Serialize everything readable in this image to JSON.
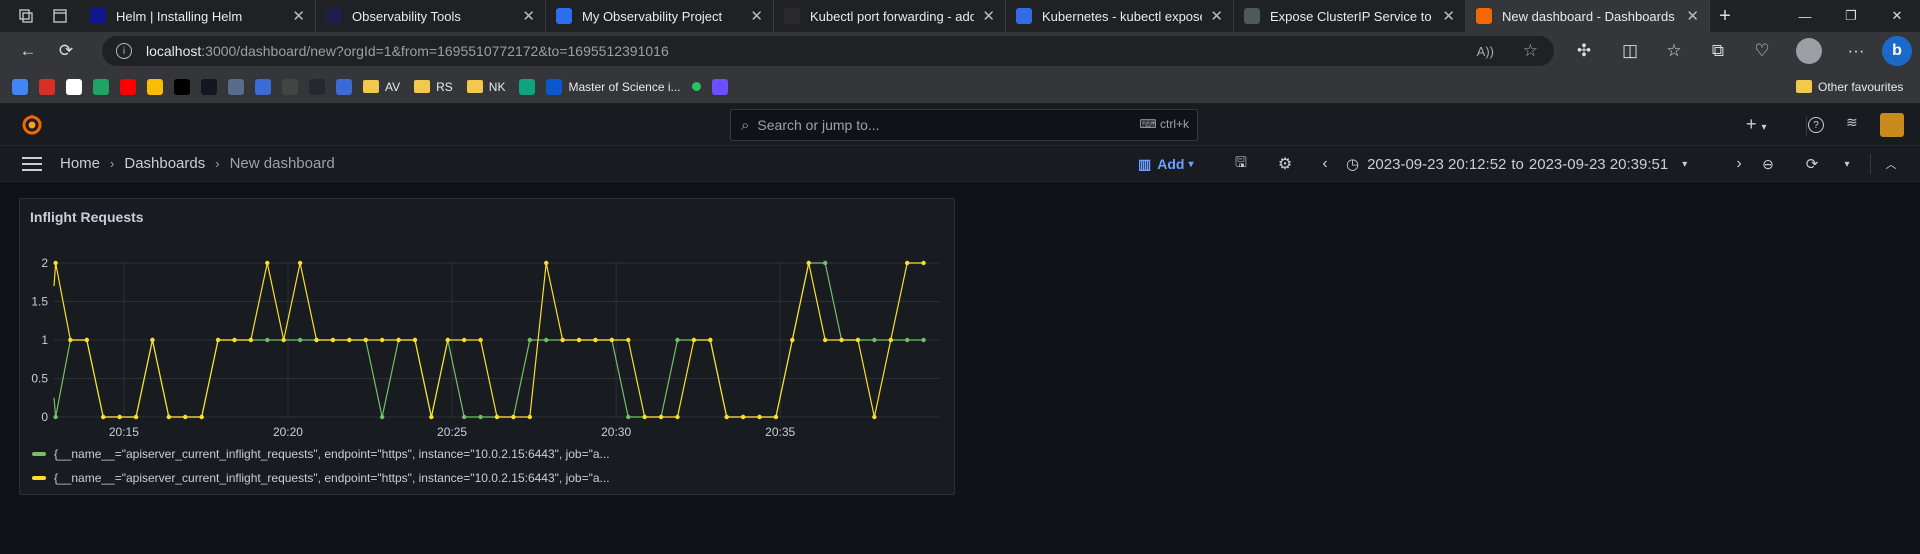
{
  "browser": {
    "tabs": [
      {
        "title": "Helm | Installing Helm",
        "color": "#0f1689",
        "icon": "helm-icon"
      },
      {
        "title": "Observability Tools",
        "color": "#1c1f4a",
        "icon": "observability-icon"
      },
      {
        "title": "My Observability Project",
        "color": "#2b6ff0",
        "icon": "project-icon"
      },
      {
        "title": "Kubectl port forwarding - addr",
        "color": "#2a2a2a",
        "icon": "s-icon"
      },
      {
        "title": "Kubernetes - kubectl expose",
        "color": "#326ce5",
        "icon": "kubernetes-icon"
      },
      {
        "title": "Expose ClusterIP Service to Inte",
        "color": "#4d5a56",
        "icon": "chatgpt-icon"
      },
      {
        "title": "New dashboard - Dashboards",
        "color": "#f46800",
        "icon": "grafana-icon",
        "active": true
      }
    ],
    "url_host": "localhost",
    "url_rest": ":3000/dashboard/new?orgId=1&from=1695510772172&to=1695512391016",
    "bookmarks": [
      {
        "type": "icon",
        "color": "#4285f4",
        "icon": "translate-icon"
      },
      {
        "type": "icon",
        "color": "#d93025",
        "icon": "gmail-icon"
      },
      {
        "type": "icon",
        "color": "#ffffff",
        "icon": "google-icon"
      },
      {
        "type": "icon",
        "color": "#1fa463",
        "icon": "drive-icon"
      },
      {
        "type": "icon",
        "color": "#ff0000",
        "icon": "youtube-icon"
      },
      {
        "type": "icon",
        "color": "#fbbc04",
        "icon": "photos-icon"
      },
      {
        "type": "icon",
        "color": "#000000",
        "icon": "x-icon"
      },
      {
        "type": "icon",
        "color": "#131722",
        "icon": "tradingview-icon"
      },
      {
        "type": "icon",
        "color": "#5b6b8c",
        "icon": "site-icon"
      },
      {
        "type": "icon",
        "color": "#3d6bd6",
        "icon": "link-icon"
      },
      {
        "type": "icon",
        "color": "#444444",
        "icon": "screen-icon"
      },
      {
        "type": "icon",
        "color": "#24292e",
        "icon": "github-icon"
      },
      {
        "type": "icon",
        "color": "#3d6bd6",
        "icon": "link-icon"
      },
      {
        "type": "folder",
        "label": "AV"
      },
      {
        "type": "folder",
        "label": "RS"
      },
      {
        "type": "folder",
        "label": "NK"
      },
      {
        "type": "icon",
        "color": "#10a37f",
        "icon": "chatgpt-icon"
      },
      {
        "type": "link",
        "color": "#0b57d0",
        "icon": "coursera-icon",
        "label": "Master of Science i..."
      },
      {
        "type": "icon",
        "color": "#22c55e",
        "icon": "dot-icon"
      },
      {
        "type": "icon",
        "color": "#6b4eff",
        "icon": "tool-icon"
      }
    ],
    "other_favourites": "Other favourites"
  },
  "grafana": {
    "search_placeholder": "Search or jump to...",
    "search_shortcut": "ctrl+k",
    "breadcrumbs": [
      "Home",
      "Dashboards",
      "New dashboard"
    ],
    "add_label": "Add",
    "time_from": "2023-09-23 20:12:52",
    "time_sep": "to",
    "time_to": "2023-09-23 20:39:51"
  },
  "panel": {
    "title": "Inflight Requests",
    "legend": [
      {
        "label": "{__name__=\"apiserver_current_inflight_requests\", endpoint=\"https\", instance=\"10.0.2.15:6443\", job=\"a...",
        "color": "#73bf69"
      },
      {
        "label": "{__name__=\"apiserver_current_inflight_requests\", endpoint=\"https\", instance=\"10.0.2.15:6443\", job=\"a...",
        "color": "#fade2a"
      }
    ]
  },
  "chart_data": {
    "type": "line",
    "x_ticks": [
      "20:15",
      "20:20",
      "20:25",
      "20:30",
      "20:35"
    ],
    "x_tick_minutes": [
      2.13,
      7.13,
      12.13,
      17.13,
      22.13
    ],
    "y_ticks": [
      "0",
      "0.5",
      "1",
      "1.5",
      "2"
    ],
    "ylim": [
      0,
      2
    ],
    "xlim": [
      0,
      27
    ],
    "grid": true,
    "series": [
      {
        "color": "#73bf69",
        "x": [
          0,
          0.05,
          0.5,
          1.0,
          1.5,
          2.0,
          2.5,
          3.0,
          3.5,
          4.0,
          4.5,
          5.0,
          5.5,
          6.0,
          6.5,
          7.0,
          7.5,
          8.0,
          8.5,
          9.0,
          9.5,
          10.0,
          10.5,
          11.0,
          11.5,
          12.0,
          12.5,
          13.0,
          13.5,
          14.0,
          14.5,
          15.0,
          15.5,
          16.0,
          16.5,
          17.0,
          17.5,
          18.0,
          18.5,
          19.0,
          19.5,
          20.0,
          20.5,
          21.0,
          21.5,
          22.0,
          22.5,
          23.0,
          23.5,
          24.0,
          24.5,
          25.0,
          25.5,
          26.0,
          26.5
        ],
        "values": [
          0.25,
          0,
          1,
          1,
          0,
          0,
          0,
          1,
          0,
          0,
          0,
          1,
          1,
          1,
          1,
          1,
          1,
          1,
          1,
          1,
          1,
          0,
          1,
          1,
          0,
          1,
          0,
          0,
          0,
          0,
          1,
          1,
          1,
          1,
          1,
          1,
          0,
          0,
          0,
          1,
          1,
          1,
          0,
          0,
          0,
          0,
          1,
          2,
          2,
          1,
          1,
          1,
          1,
          1,
          1
        ]
      },
      {
        "color": "#fade2a",
        "x": [
          0,
          0.05,
          0.5,
          1.0,
          1.5,
          2.0,
          2.5,
          3.0,
          3.5,
          4.0,
          4.5,
          5.0,
          5.5,
          6.0,
          6.5,
          7.0,
          7.5,
          8.0,
          8.5,
          9.0,
          9.5,
          10.0,
          10.5,
          11.0,
          11.5,
          12.0,
          12.5,
          13.0,
          13.5,
          14.0,
          14.5,
          15.0,
          15.5,
          16.0,
          16.5,
          17.0,
          17.5,
          18.0,
          18.5,
          19.0,
          19.5,
          20.0,
          20.5,
          21.0,
          21.5,
          22.0,
          22.5,
          23.0,
          23.5,
          24.0,
          24.5,
          25.0,
          25.5,
          26.0,
          26.5
        ],
        "values": [
          1.7,
          2,
          1,
          1,
          0,
          0,
          0,
          1,
          0,
          0,
          0,
          1,
          1,
          1,
          2,
          1,
          2,
          1,
          1,
          1,
          1,
          1,
          1,
          1,
          0,
          1,
          1,
          1,
          0,
          0,
          0,
          2,
          1,
          1,
          1,
          1,
          1,
          0,
          0,
          0,
          1,
          1,
          0,
          0,
          0,
          0,
          1,
          2,
          1,
          1,
          1,
          0,
          1,
          2,
          2
        ]
      }
    ]
  }
}
